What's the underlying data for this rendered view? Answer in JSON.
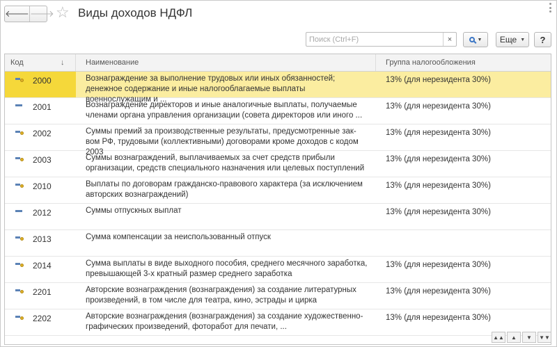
{
  "window": {
    "title": "Виды доходов НДФЛ"
  },
  "icons": {
    "back": "arrow-left-icon",
    "forward": "arrow-right-icon",
    "favorite": "star-icon",
    "search": "search-icon",
    "clear": "close-icon",
    "more": "more-vertical-icon",
    "help": "help-icon"
  },
  "toolbar": {
    "search_placeholder": "Поиск (Ctrl+F)",
    "clear_label": "×",
    "more_label": "Еще",
    "help_label": "?"
  },
  "table": {
    "columns": [
      "Код",
      "Наименование",
      "Группа налогообложения"
    ],
    "sort_indicator": "↓",
    "rows": [
      {
        "code": "2000",
        "name": "Вознаграждение за выполнение трудовых или иных обязанностей; денежное содержание и иные налогооблагаемые выплаты военнослужащим и ...",
        "group": "13% (для нерезидента 30%)",
        "selected": true,
        "icon": "dot"
      },
      {
        "code": "2001",
        "name": "Вознаграждение директоров и иные аналогичные выплаты, получаемые членами органа управления организации (совета директоров или иного ...",
        "group": "13% (для нерезидента 30%)",
        "selected": false,
        "icon": "dash"
      },
      {
        "code": "2002",
        "name": "Суммы премий за производственные результаты, предусмотренные зак-вом РФ, трудовыми (коллективными) договорами кроме доходов с кодом 2003",
        "group": "13% (для нерезидента 30%)",
        "selected": false,
        "icon": "dot"
      },
      {
        "code": "2003",
        "name": "Суммы вознаграждений, выплачиваемых за счет средств прибыли организации, средств специального назначения или целевых поступлений",
        "group": "13% (для нерезидента 30%)",
        "selected": false,
        "icon": "dot"
      },
      {
        "code": "2010",
        "name": "Выплаты по договорам гражданско-правового характера (за исключением авторских вознаграждений)",
        "group": "13% (для нерезидента 30%)",
        "selected": false,
        "icon": "dot"
      },
      {
        "code": "2012",
        "name": "Суммы отпускных выплат",
        "group": "13% (для нерезидента 30%)",
        "selected": false,
        "icon": "dash"
      },
      {
        "code": "2013",
        "name": "Сумма компенсации за неиспользованный отпуск",
        "group": "",
        "selected": false,
        "icon": "dot"
      },
      {
        "code": "2014",
        "name": "Сумма выплаты в виде выходного пособия, среднего месячного заработка, превышающей 3-х кратный размер среднего заработка",
        "group": "13% (для нерезидента 30%)",
        "selected": false,
        "icon": "dot"
      },
      {
        "code": "2201",
        "name": "Авторские вознаграждения (вознаграждения) за создание литературных произведений, в том числе для театра, кино, эстрады и цирка",
        "group": "13% (для нерезидента 30%)",
        "selected": false,
        "icon": "dot"
      },
      {
        "code": "2202",
        "name": "Авторские вознаграждения (вознаграждения) за создание художественно-графических произведений, фоторабот для печати, ...",
        "group": "13% (для нерезидента 30%)",
        "selected": false,
        "icon": "dot"
      }
    ]
  },
  "pager": {
    "first": "▲▲",
    "prev": "▲",
    "next": "▼",
    "last": "▼▼"
  }
}
